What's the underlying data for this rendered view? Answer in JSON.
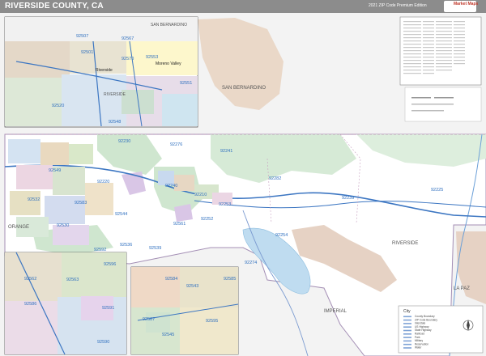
{
  "header": {
    "title": "RIVERSIDE COUNTY, CA",
    "edition": "2021 ZIP Code Premium Edition",
    "logo_label": "Market Maps"
  },
  "map": {
    "county_labels": {
      "san_bernardino_main": "SAN BERNARDINO",
      "san_bernardino_inset": "SAN BERNARDINO",
      "riverside_main": "RIVERSIDE",
      "riverside_inset": "RIVERSIDE",
      "imperial": "IMPERIAL",
      "la_paz": "LA PAZ",
      "orange": "ORANGE"
    },
    "place_labels": {
      "riverside_city": "Riverside",
      "moreno_valley": "Moreno Valley"
    },
    "zip_labels": {
      "z1": "92252",
      "z2": "92241",
      "z3": "92240",
      "z4": "92282",
      "z5": "92239",
      "z6": "92225",
      "z7": "92254",
      "z8": "92274",
      "z9": "92544",
      "z10": "92586",
      "z11": "92596",
      "z12": "92592",
      "z13": "92539",
      "z14": "92536",
      "z15": "92561",
      "z16": "92583",
      "z17": "92530",
      "z18": "92532",
      "z19": "92567",
      "z20": "92553",
      "z21": "92507",
      "z22": "92501",
      "z23": "92570",
      "z24": "92520",
      "z25": "92548",
      "z26": "92563",
      "z27": "92562",
      "z28": "92543",
      "z29": "92545",
      "z30": "92551",
      "z31": "92230",
      "z32": "92276",
      "z33": "92210",
      "z34": "92253",
      "z35": "92591",
      "z36": "92590",
      "z37": "92595",
      "z38": "92584",
      "z39": "92585",
      "z40": "92587",
      "z41": "92549",
      "z42": "92220"
    },
    "colors": {
      "land": "#ffffff",
      "outside": "#f2f2f2",
      "national_forest": "#cfe6cf",
      "military": "#ead8c8",
      "reservation": "#d9c6e6",
      "water": "#bfdcf0",
      "highway": "#3c76c2",
      "zip_text": "#2e6fbf"
    },
    "legend": {
      "title": "City",
      "rows": [
        "County Boundary",
        "ZIP Code Boundary",
        "Interstate",
        "US Highway",
        "State Highway",
        "Railroad",
        "Park",
        "Military",
        "Reservation",
        "Water"
      ]
    }
  }
}
